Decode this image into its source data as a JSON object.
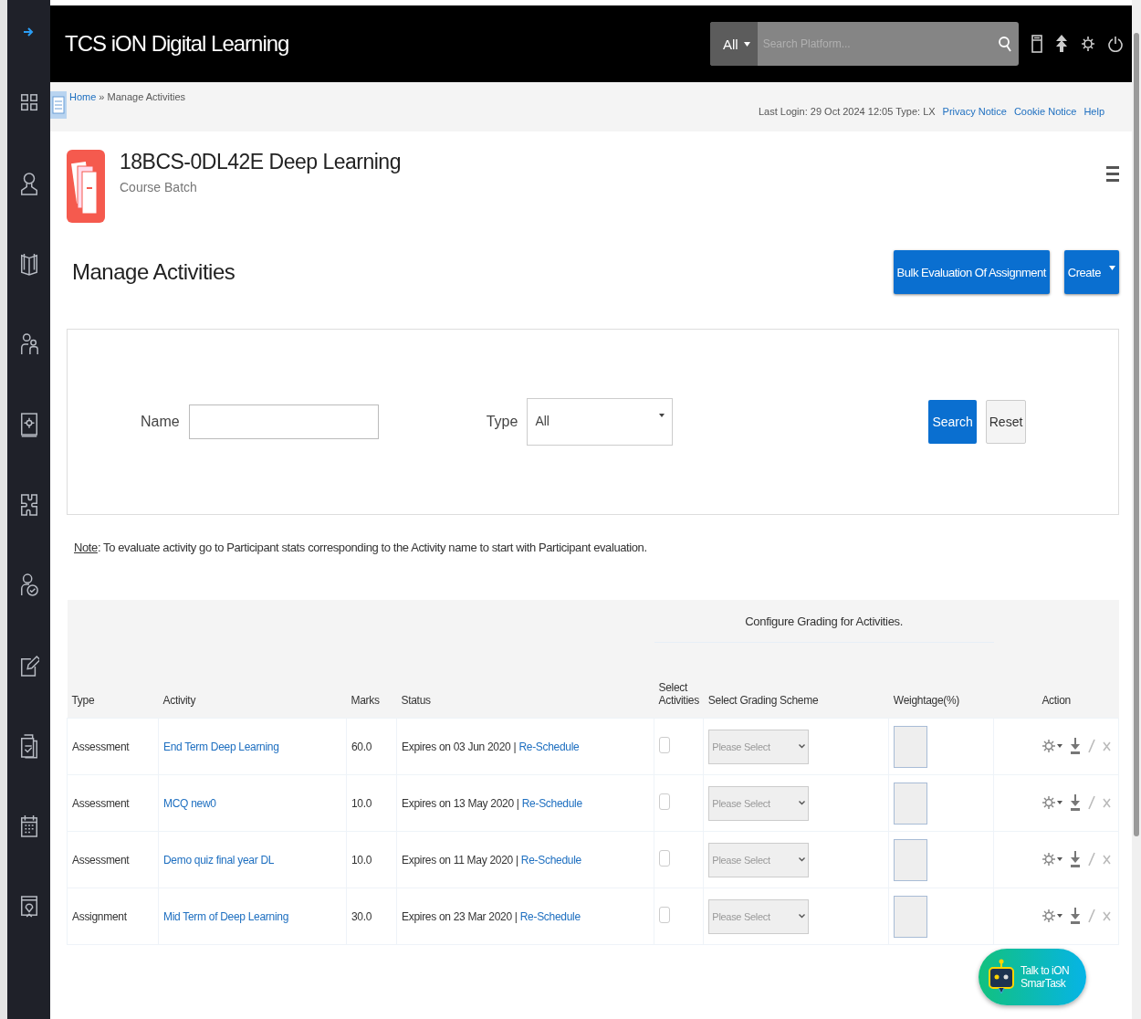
{
  "header": {
    "logo": "TCS iON Digital Learning",
    "search_scope": "All",
    "search_placeholder": "Search Platform..."
  },
  "breadcrumb": {
    "home": "Home",
    "rest": "» Manage Activities"
  },
  "login_info": "Last Login: 29 Oct 2024 12:05 Type: LX",
  "top_links": [
    "Privacy Notice",
    "Cookie Notice",
    "Help"
  ],
  "course": {
    "title": "18BCS-0DL42E Deep Learning",
    "subtitle": "Course Batch"
  },
  "page_title": "Manage Activities",
  "buttons": [
    {
      "label": "Bulk Evaluation Of Assignment",
      "kind": "plain"
    },
    {
      "label": "Create",
      "kind": "dropdown"
    }
  ],
  "filter": {
    "name_label": "Name",
    "type_label": "Type",
    "type_value": "All",
    "buttons": [
      "Search",
      "Reset"
    ]
  },
  "note": {
    "label": "Note",
    "text": ": To evaluate activity go to Participant stats corresponding to the Activity name to start with Participant evaluation."
  },
  "table": {
    "group_header": "Configure Grading for Activities.",
    "columns": [
      "Type",
      "Activity",
      "Marks",
      "Status",
      "Select Activities",
      "Select Grading Scheme",
      "Weightage(%)",
      "Action"
    ],
    "rows": [
      {
        "type": "Assessment",
        "activity": "End Term Deep Learning",
        "marks": "60.0",
        "status": "Expires on 03 Jun 2020 |",
        "link": "Re-Schedule",
        "checked": false,
        "scheme": "Please Select"
      },
      {
        "type": "Assessment",
        "activity": "MCQ new0",
        "marks": "10.0",
        "status": "Expires on 13 May 2020 |",
        "link": "Re-Schedule",
        "checked": false,
        "scheme": "Please Select"
      },
      {
        "type": "Assessment",
        "activity": "Demo quiz final year DL",
        "marks": "10.0",
        "status": "Expires on 11 May 2020 |",
        "link": "Re-Schedule",
        "checked": false,
        "scheme": "Please Select"
      },
      {
        "type": "Assignment",
        "activity": "Mid Term of Deep Learning",
        "marks": "30.0",
        "status": "Expires on 23 Mar 2020 |",
        "link": "Re-Schedule",
        "checked": false,
        "scheme": "Please Select"
      }
    ]
  },
  "chat": {
    "lines": [
      "Talk to iON",
      "SmarTask"
    ]
  }
}
